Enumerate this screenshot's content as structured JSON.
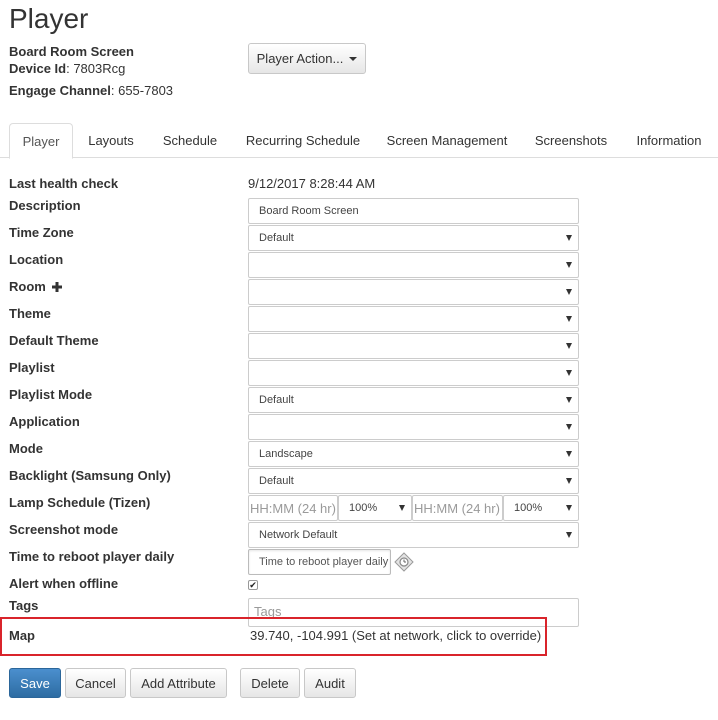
{
  "page": {
    "title": "Player"
  },
  "device": {
    "name": "Board Room Screen",
    "device_id_label": "Device Id",
    "device_id": "7803Rcg",
    "channel_label": "Engage Channel",
    "channel": "655-7803"
  },
  "player_action_label": "Player Action...",
  "tabs": [
    "Player",
    "Layouts",
    "Schedule",
    "Recurring Schedule",
    "Screen Management",
    "Screenshots",
    "Information"
  ],
  "active_tab": "Player",
  "form": {
    "last_health_check": {
      "label": "Last health check",
      "value": "9/12/2017 8:28:44 AM"
    },
    "description": {
      "label": "Description",
      "value": "Board Room Screen"
    },
    "time_zone": {
      "label": "Time Zone",
      "value": "Default"
    },
    "location": {
      "label": "Location",
      "value": ""
    },
    "room": {
      "label": "Room",
      "value": ""
    },
    "theme": {
      "label": "Theme",
      "value": ""
    },
    "default_theme": {
      "label": "Default Theme",
      "value": ""
    },
    "playlist": {
      "label": "Playlist",
      "value": ""
    },
    "playlist_mode": {
      "label": "Playlist Mode",
      "value": "Default"
    },
    "application": {
      "label": "Application",
      "value": ""
    },
    "mode": {
      "label": "Mode",
      "value": "Landscape"
    },
    "backlight": {
      "label": "Backlight (Samsung Only)",
      "value": "Default"
    },
    "lamp_schedule": {
      "label": "Lamp Schedule (Tizen)",
      "start_placeholder": "HH:MM (24 hr)",
      "start_level": "100%",
      "end_placeholder": "HH:MM (24 hr)",
      "end_level": "100%"
    },
    "screenshot_mode": {
      "label": "Screenshot mode",
      "value": "Network Default"
    },
    "reboot_time": {
      "label": "Time to reboot player daily",
      "placeholder": "Time to reboot player daily"
    },
    "alert_offline": {
      "label": "Alert when offline",
      "checked": true,
      "check_glyph": "✔"
    },
    "tags": {
      "label": "Tags",
      "placeholder": "Tags"
    },
    "map": {
      "label": "Map",
      "value": "39.740, -104.991 (Set at network, click to override)"
    }
  },
  "buttons": {
    "save": "Save",
    "cancel": "Cancel",
    "add_attribute": "Add Attribute",
    "delete": "Delete",
    "audit": "Audit"
  },
  "icons": {
    "room_add": "plus-icon",
    "reboot_clock": "time-picker-icon"
  },
  "colors": {
    "primary": "#337ab7",
    "highlight": "#d9242b"
  }
}
